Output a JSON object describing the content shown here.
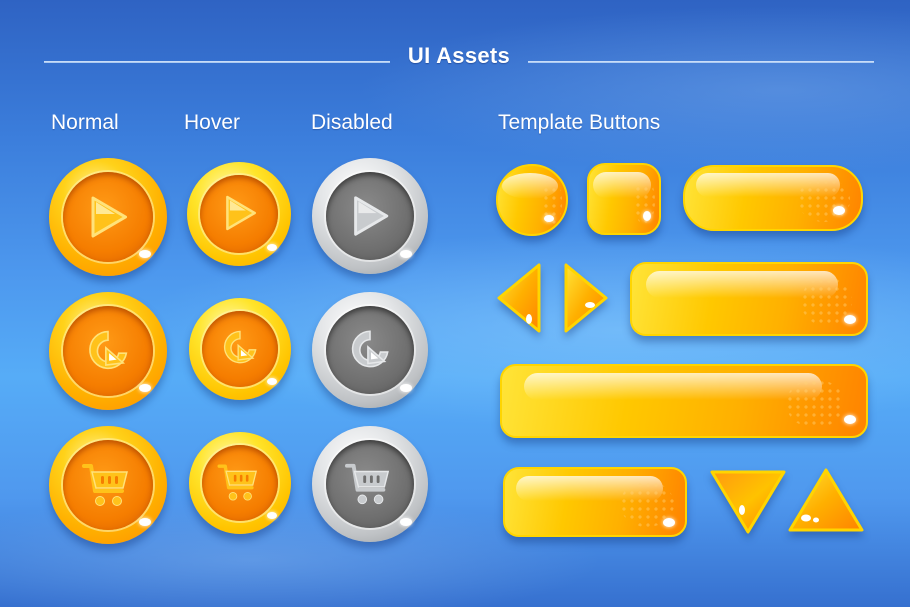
{
  "header": {
    "title": "UI Assets"
  },
  "columns": {
    "normal": "Normal",
    "hover": "Hover",
    "disabled": "Disabled",
    "template": "Template Buttons"
  },
  "state_buttons": {
    "rows": [
      {
        "icon": "play-icon",
        "states": [
          "normal",
          "hover",
          "disabled"
        ]
      },
      {
        "icon": "replay-icon",
        "states": [
          "normal",
          "hover",
          "disabled"
        ]
      },
      {
        "icon": "shopping-cart-icon",
        "states": [
          "normal",
          "hover",
          "disabled"
        ]
      }
    ]
  },
  "template_buttons": [
    {
      "shape": "circle"
    },
    {
      "shape": "rounded-square"
    },
    {
      "shape": "pill"
    },
    {
      "shape": "triangle-left"
    },
    {
      "shape": "triangle-right"
    },
    {
      "shape": "wide-rectangle"
    },
    {
      "shape": "extra-wide-rectangle"
    },
    {
      "shape": "medium-rectangle"
    },
    {
      "shape": "triangle-down"
    },
    {
      "shape": "triangle-up"
    }
  ],
  "colors": {
    "background": "#4a90e8",
    "orange_accent": "#ff8c00",
    "yellow_accent": "#ffd21a",
    "disabled_grey": "#8a8a8a",
    "text": "#ffffff"
  }
}
